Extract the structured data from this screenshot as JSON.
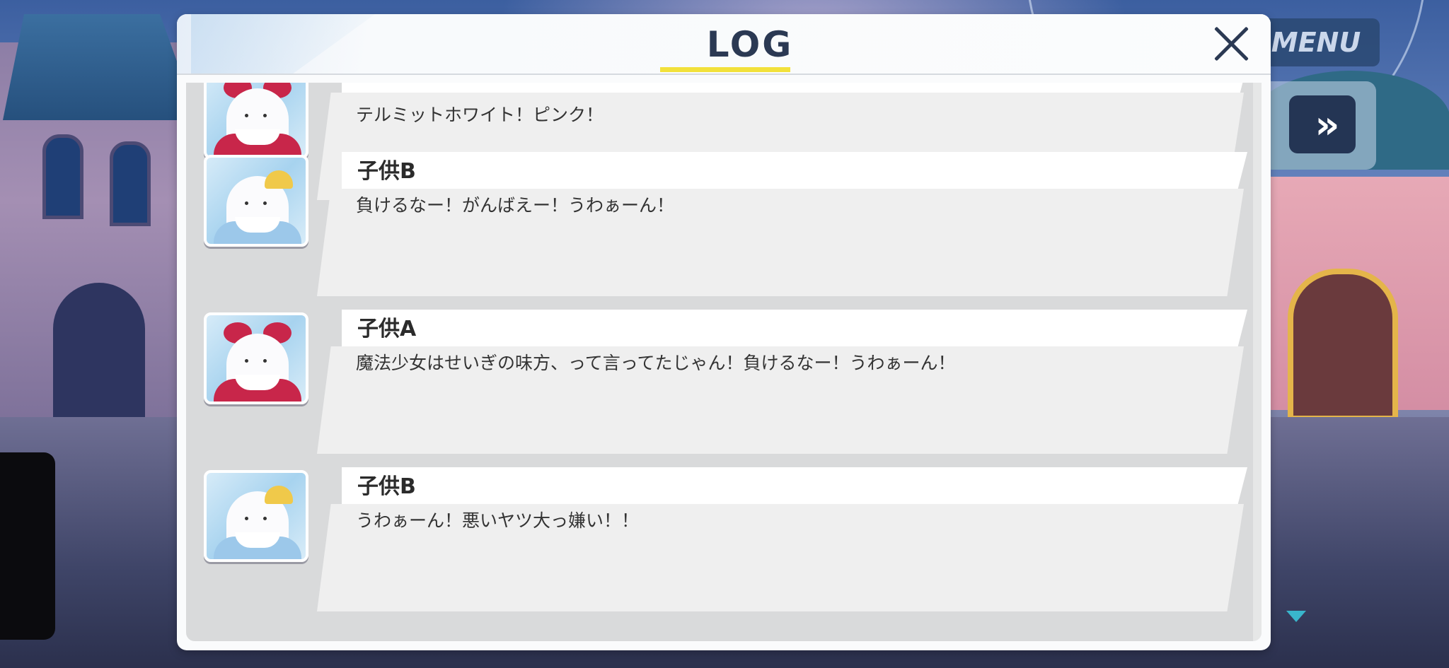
{
  "hud": {
    "menu_label": "MENU",
    "skip_label": "»"
  },
  "dialog": {
    "title": "LOG",
    "close_label": "close"
  },
  "entries": [
    {
      "speaker": "",
      "text": "テルミットホワイト！ピンク！",
      "avatar": "red-ribbon-child-avatar"
    },
    {
      "speaker": "子供B",
      "text": "負けるなー！がんばえー！うわぁーん！",
      "avatar": "yellow-hat-child-avatar"
    },
    {
      "speaker": "子供A",
      "text": "魔法少女はせいぎの味方、って言ってたじゃん！負けるなー！うわぁーん！",
      "avatar": "red-ribbon-child-avatar"
    },
    {
      "speaker": "子供B",
      "text": "うわぁーん！悪いヤツ大っ嫌い！！",
      "avatar": "yellow-hat-child-avatar"
    }
  ],
  "colors": {
    "title_underline": "#f2e13b",
    "title_text": "#2b3953",
    "bubble": "#efefef",
    "panel": "#d9dadb"
  }
}
